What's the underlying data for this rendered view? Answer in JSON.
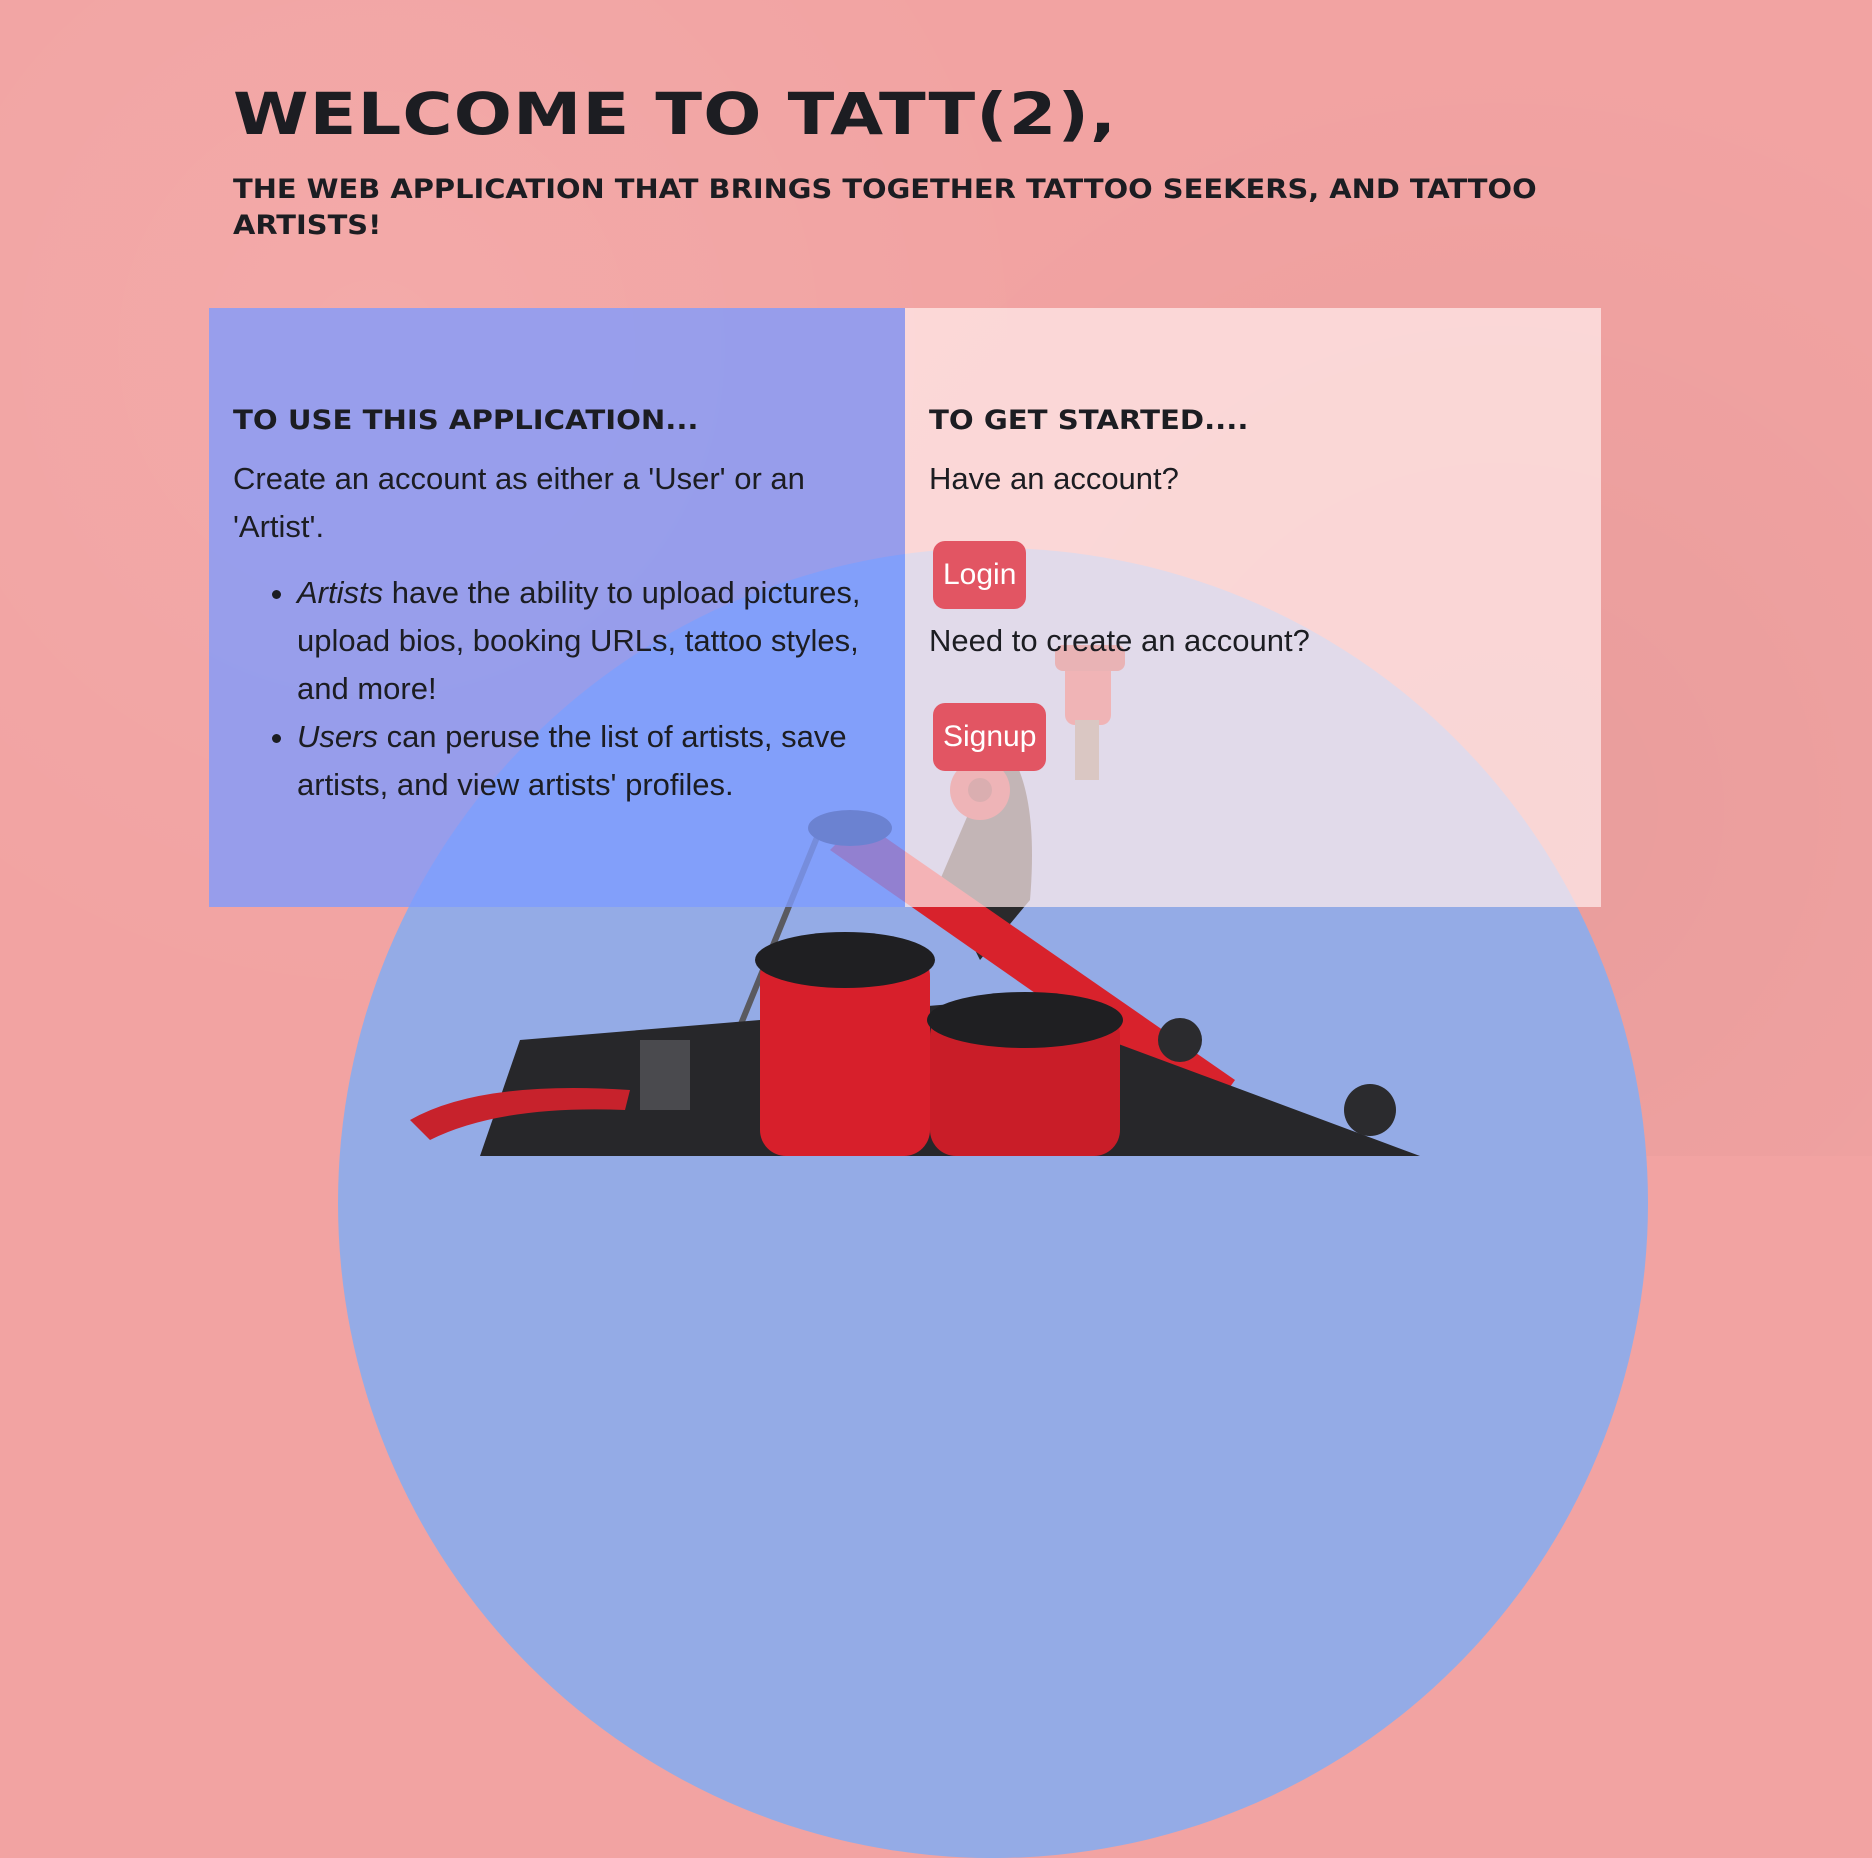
{
  "hero": {
    "title": "WELCOME TO TATT(2),",
    "subtitle": "THE WEB APPLICATION THAT BRINGS TOGETHER TATTOO SEEKERS, AND TATTOO ARTISTS!"
  },
  "left_panel": {
    "heading": "TO USE THIS APPLICATION...",
    "intro": "Create an account as either a 'User' or an 'Artist'.",
    "bullets": [
      {
        "em": "Artists",
        "text": " have the ability to upload pictures, upload bios, booking URLs, tattoo styles, and more!"
      },
      {
        "em": "Users",
        "text": " can peruse the list of artists, save artists, and view artists' profiles."
      }
    ]
  },
  "right_panel": {
    "heading": "TO GET STARTED....",
    "have_account": "Have an account?",
    "login_label": "Login",
    "need_account": "Need to create an account?",
    "signup_label": "Signup"
  },
  "colors": {
    "background": "#f2a3a2",
    "circle": "#94abe6",
    "left_panel": "#7d9bff",
    "right_panel": "#ffecec",
    "button": "#e25563"
  },
  "icons": [
    "tattoo-machine-illustration"
  ]
}
